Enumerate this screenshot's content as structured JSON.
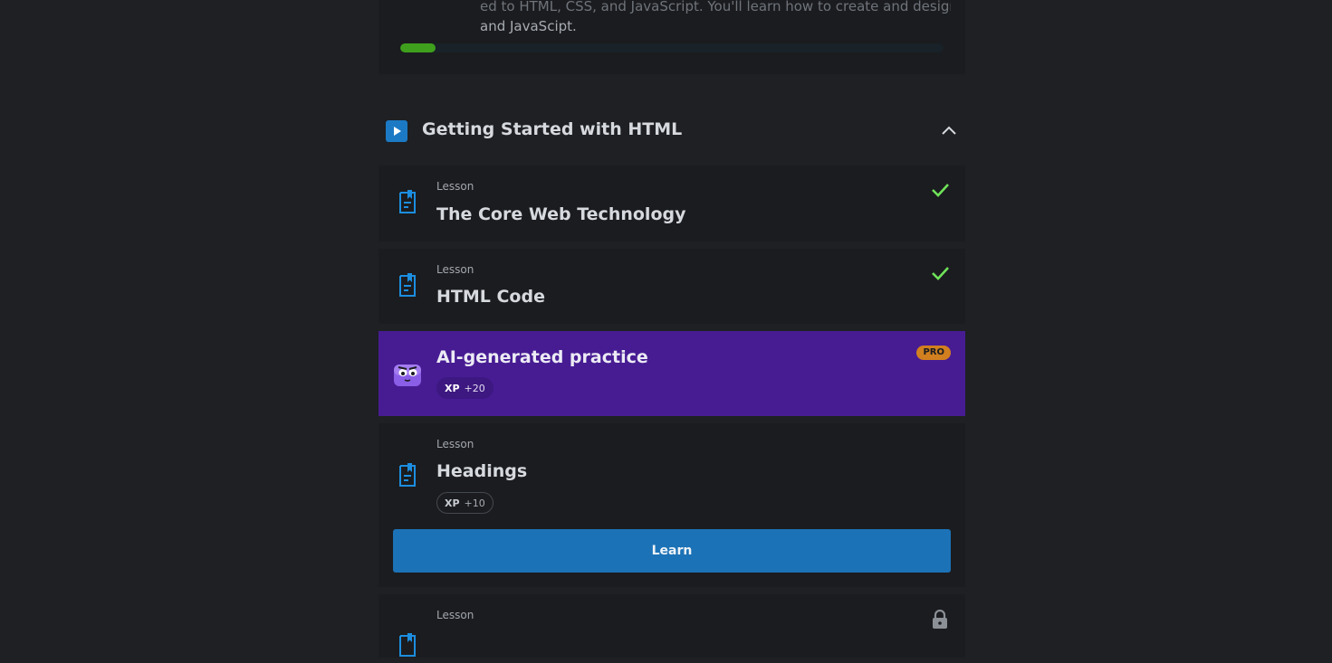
{
  "course": {
    "description_line1": "ed to HTML, CSS, and JavaScript. You'll learn how to create and design websites with HTML, CSS,",
    "description_line2": "and JavaScipt.",
    "progress": 0.065,
    "progress_color": "#3fa01d"
  },
  "section": {
    "title": "Getting Started with HTML",
    "icon": "play-icon",
    "collapse_icon": "chevron-up-icon"
  },
  "lessons": [
    {
      "kicker": "Lesson",
      "title": "The Core Web Technology",
      "status": "completed",
      "status_icon": "check-icon"
    },
    {
      "kicker": "Lesson",
      "title": "HTML Code",
      "status": "completed",
      "status_icon": "check-icon"
    },
    {
      "kicker": "Lesson",
      "title": "Headings",
      "xp_label": "XP",
      "xp_value": "+10",
      "button_label": "Learn"
    },
    {
      "kicker": "Lesson",
      "status": "locked",
      "status_icon": "lock-icon"
    }
  ],
  "ai_practice": {
    "title": "AI-generated practice",
    "badge": "PRO",
    "xp_label": "XP",
    "xp_value": "+20",
    "mascot_icon": "bot-mascot-icon",
    "background": "#471c93"
  },
  "colors": {
    "background": "#1e2023",
    "card": "#1b1c1f",
    "accent_blue": "#1c72b6",
    "check_green": "#6fe35a",
    "pro_orange": "#d17f1f"
  }
}
